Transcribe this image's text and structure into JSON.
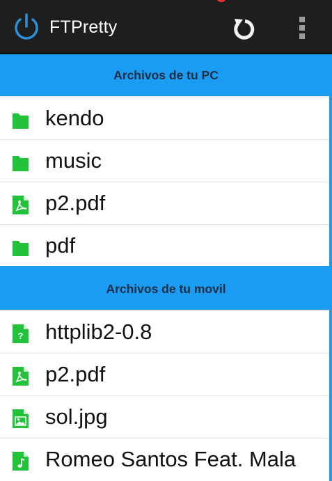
{
  "app": {
    "title": "FTPretty",
    "accent_color": "#1a9cf3",
    "icon_color": "#22c33a",
    "icons": {
      "app": "power-icon",
      "refresh": "refresh-icon",
      "menu": "overflow-menu-icon"
    }
  },
  "sections": [
    {
      "header": "Archivos de tu PC",
      "items": [
        {
          "name": "kendo",
          "icon": "folder-icon"
        },
        {
          "name": "music",
          "icon": "folder-icon"
        },
        {
          "name": "p2.pdf",
          "icon": "pdf-file-icon"
        },
        {
          "name": "pdf",
          "icon": "folder-icon"
        }
      ]
    },
    {
      "header": "Archivos de tu movil",
      "items": [
        {
          "name": "httplib2-0.8",
          "icon": "unknown-file-icon"
        },
        {
          "name": "p2.pdf",
          "icon": "pdf-file-icon"
        },
        {
          "name": "sol.jpg",
          "icon": "image-file-icon"
        },
        {
          "name": "Romeo Santos Feat. Mala",
          "icon": "music-file-icon"
        }
      ]
    }
  ]
}
